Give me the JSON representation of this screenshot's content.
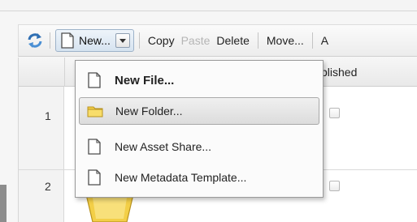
{
  "toolbar": {
    "new_label": "New...",
    "items": [
      "Copy",
      "Paste",
      "Delete",
      "Move...",
      "A"
    ],
    "disabled": [
      false,
      true,
      false,
      false,
      false
    ]
  },
  "grid": {
    "header_published": "blished",
    "rows": [
      "1",
      "2"
    ]
  },
  "menu": {
    "items": [
      {
        "label": "New File...",
        "icon": "file-icon",
        "bold": true
      },
      {
        "label": "New Folder...",
        "icon": "folder-icon",
        "highlight": true
      },
      {
        "label": "New Asset Share...",
        "icon": "file-icon"
      },
      {
        "label": "New Metadata Template...",
        "icon": "file-icon"
      }
    ]
  },
  "colors": {
    "new_button_border": "#9db2c9",
    "folder_yellow": "#f3cf47",
    "disabled_text": "#b5b5b5"
  }
}
